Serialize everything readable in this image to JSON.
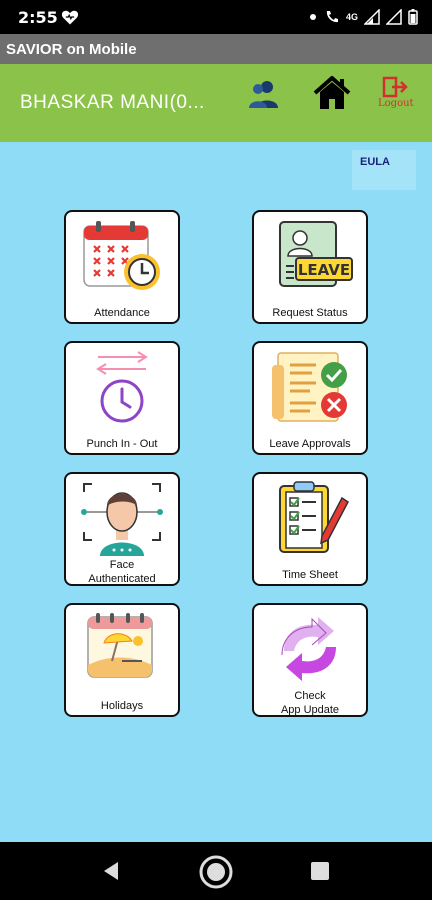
{
  "status_bar": {
    "time": "2:55",
    "network": "4G"
  },
  "app": {
    "title": "SAVIOR on Mobile"
  },
  "header": {
    "user_name": "BHASKAR MANI(0...",
    "logout_label": "Logout"
  },
  "eula": {
    "label": "EULA"
  },
  "tiles": [
    {
      "label": "Attendance",
      "icon": "attendance-calendar-clock-icon"
    },
    {
      "label": "Request  Status",
      "icon": "leave-request-icon"
    },
    {
      "label": "Punch In - Out",
      "icon": "punch-clock-icon"
    },
    {
      "label": "Leave Approvals",
      "icon": "approval-document-icon"
    },
    {
      "label_line1": "Face",
      "label_line2": "Authenticated",
      "icon": "face-scan-icon"
    },
    {
      "label": "Time  Sheet",
      "icon": "checklist-icon"
    },
    {
      "label": "Holidays",
      "icon": "beach-calendar-icon"
    },
    {
      "label_line1": "Check",
      "label_line2": "App  Update",
      "icon": "sync-arrows-icon"
    }
  ],
  "colors": {
    "background": "#8fdcf7",
    "header": "#8bc34a",
    "titlebar": "#6f6f6f"
  }
}
